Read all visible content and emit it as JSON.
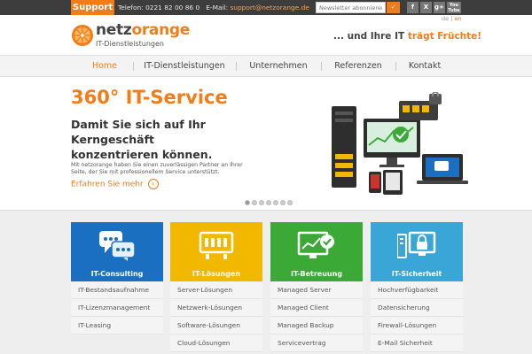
{
  "topbar": {
    "support_label": "Support",
    "phone_label": "Telefon:",
    "phone": "0221 82 00 86 0",
    "email_label": "E-Mail:",
    "email": "support@netzorange.de",
    "newsletter_placeholder": "Newsletter abonnieren",
    "newsletter_button": "✓",
    "social": [
      {
        "label": "f",
        "icon": "facebook-icon"
      },
      {
        "label": "X",
        "icon": "xing-icon"
      },
      {
        "label": "g+",
        "icon": "googleplus-icon"
      },
      {
        "label": "You\nTube",
        "icon": "youtube-icon"
      }
    ],
    "lang_de": "de",
    "lang_sep": "|",
    "lang_en": "en"
  },
  "header": {
    "logo_name_1": "netz",
    "logo_name_2": "orange",
    "logo_sub": "IT-Dienstleistungen",
    "tagline_1": "... und Ihre IT ",
    "tagline_2": "trägt Früchte!"
  },
  "nav": {
    "items": [
      {
        "label": "Home"
      },
      {
        "label": "IT-Dienstleistungen"
      },
      {
        "label": "Unternehmen"
      },
      {
        "label": "Referenzen"
      },
      {
        "label": "Kontakt"
      }
    ]
  },
  "hero": {
    "title": "360° IT-Service",
    "subtitle": "Damit Sie sich auf Ihr Kerngeschäft konzentrieren können.",
    "text": "Mit netzorange haben Sie einen zuverlässigen Partner an Ihrer Seite, der Sie mit professionellem Service unterstützt.",
    "link": "Erfahren Sie mehr",
    "slide_count": 7,
    "active_slide": 1
  },
  "cards": [
    {
      "title": "IT-Consulting",
      "color": "#1a6fc0",
      "icon": "chat-bubbles-icon",
      "items": [
        "IT-Bestandsaufnahme",
        "IT-Lizenzmanagement",
        "IT-Leasing"
      ]
    },
    {
      "title": "IT-Lösungen",
      "color": "#f2b800",
      "icon": "server-rack-icon",
      "items": [
        "Server-Lösungen",
        "Netzwerk-Lösungen",
        "Software-Lösungen",
        "Cloud-Lösungen"
      ]
    },
    {
      "title": "IT-Betreuung",
      "color": "#3aa935",
      "icon": "monitor-check-icon",
      "items": [
        "Managed Server",
        "Managed Client",
        "Managed Backup",
        "Servicevertrag"
      ]
    },
    {
      "title": "IT-Sicherheit",
      "color": "#3aa6d8",
      "icon": "lock-screen-icon",
      "items": [
        "Hochverfügbarkeit",
        "Datensicherung",
        "Firewall-Lösungen",
        "E-Mail Sicherheit"
      ]
    }
  ]
}
